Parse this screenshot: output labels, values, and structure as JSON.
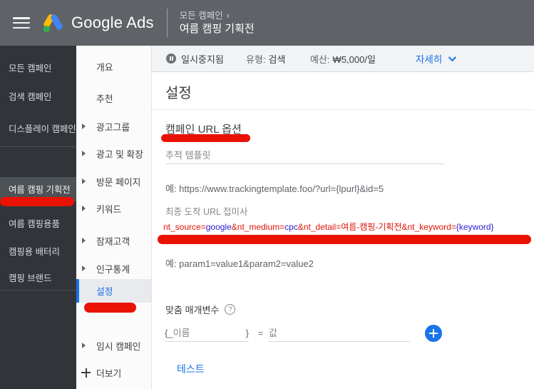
{
  "header": {
    "product_name": "Google Ads",
    "breadcrumb": {
      "parent": "모든 캠페인",
      "separator": "›",
      "current": "여름 캠핑 기획전"
    }
  },
  "campaign_rail": {
    "items": [
      {
        "label": "모든 캠페인"
      },
      {
        "label": "검색 캠페인"
      },
      {
        "label": "디스플레이 캠페인"
      },
      {
        "label": "여름 캠핑 기획전"
      },
      {
        "label": "여름 캠핑용품"
      },
      {
        "label": "캠핑용 배터리"
      },
      {
        "label": "캠핑 브랜드"
      }
    ]
  },
  "nav_rail": {
    "items": [
      {
        "label": "개요"
      },
      {
        "label": "추천"
      },
      {
        "label": "광고그룹"
      },
      {
        "label": "광고 및 확장"
      },
      {
        "label": "방문 페이지"
      },
      {
        "label": "키워드"
      },
      {
        "label": "잠재고객"
      },
      {
        "label": "인구통계"
      },
      {
        "label": "설정"
      },
      {
        "label": "임시 캠페인"
      },
      {
        "label": "더보기"
      }
    ]
  },
  "status_bar": {
    "status": "일시중지됨",
    "type_label": "유형:",
    "type_value": "검색",
    "budget_label": "예산:",
    "budget_value": "₩5,000/일",
    "details_label": "자세히"
  },
  "main": {
    "page_title": "설정",
    "section_title": "캠페인 URL 옵션",
    "tracking_template": {
      "placeholder": "추적 템플릿",
      "example": "예: https://www.trackingtemplate.foo/?url={lpurl}&id=5"
    },
    "final_url_suffix": {
      "label": "최종 도착 URL 접미사",
      "segments": [
        {
          "text": "nt_source=",
          "color": "#e11306"
        },
        {
          "text": "google",
          "color": "#2a22cf"
        },
        {
          "text": "&nt_medium=",
          "color": "#e11306"
        },
        {
          "text": "cpc",
          "color": "#2a22cf"
        },
        {
          "text": "&nt_detail=여름-캠핑-기획전&nt_keyword=",
          "color": "#e11306"
        },
        {
          "text": "{keyword}",
          "color": "#2a22cf"
        }
      ],
      "example": "예: param1=value1&param2=value2"
    },
    "custom_parameters": {
      "label": "맞춤 매개변수",
      "name_prefix": "{_",
      "name_placeholder": "이름",
      "name_suffix": "}",
      "equals": "=",
      "value_placeholder": "값"
    },
    "test_link": "테스트"
  },
  "colors": {
    "accent_blue": "#1a73e8",
    "header_gray": "#5f6368",
    "rail_dark": "#313539",
    "annotation_red": "#ea1205",
    "param_red": "#e11306",
    "param_blue": "#2a22cf"
  }
}
